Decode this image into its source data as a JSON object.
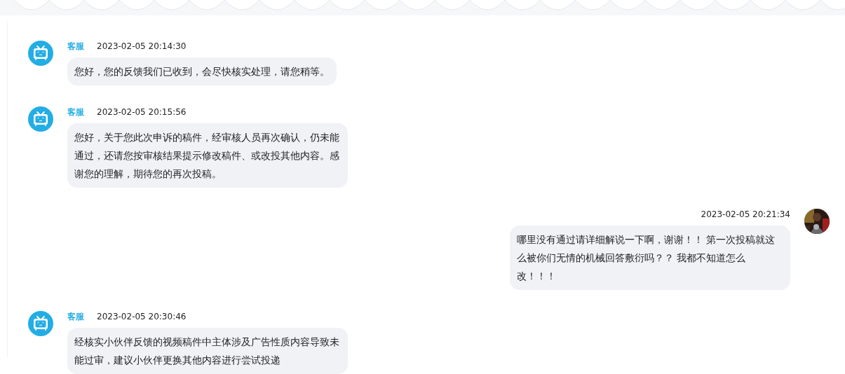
{
  "messages": [
    {
      "kind": "agent",
      "name": "客服",
      "time": "2023-02-05 20:14:30",
      "text": "您好，您的反馈我们已收到，会尽快核实处理，请您稍等。"
    },
    {
      "kind": "agent",
      "name": "客服",
      "time": "2023-02-05 20:15:56",
      "text": "您好，关于您此次申诉的稿件，经审核人员再次确认，仍未能通过，还请您按审核结果提示修改稿件、或改投其他内容。感谢您的理解，期待您的再次投稿。"
    },
    {
      "kind": "user",
      "time": "2023-02-05 20:21:34",
      "text": "哪里没有通过请详细解说一下啊，谢谢！！ 第一次投稿就这么被你们无情的机械回答敷衍吗？？ 我都不知道怎么改！！！"
    },
    {
      "kind": "agent",
      "name": "客服",
      "time": "2023-02-05 20:30:46",
      "text": "经核实小伙伴反馈的视频稿件中主体涉及广告性质内容导致未能过审，建议小伙伴更换其他内容进行尝试投递"
    }
  ]
}
